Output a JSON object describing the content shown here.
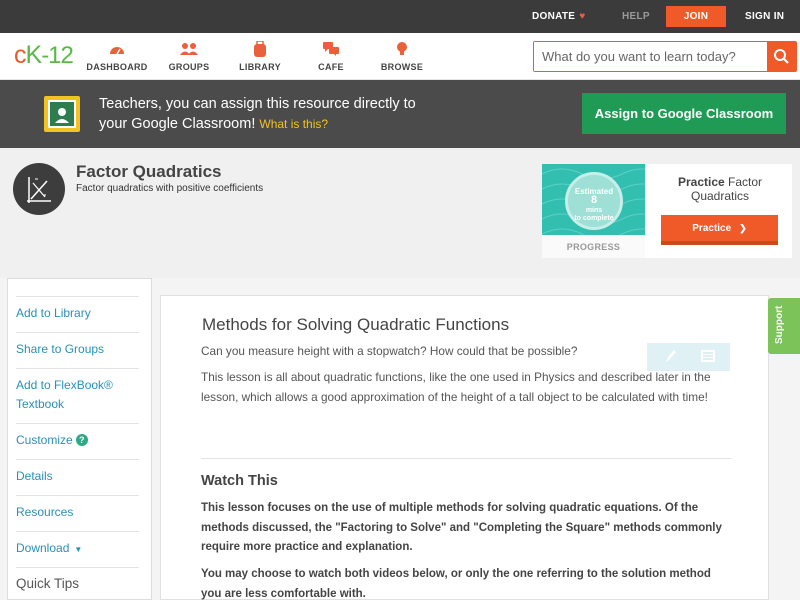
{
  "topbar": {
    "donate": "DONATE",
    "help": "HELP",
    "join": "JOIN",
    "signin": "SIGN IN"
  },
  "logo": {
    "c": "c",
    "k": "K",
    "num": "-12"
  },
  "nav": {
    "items": [
      {
        "label": "DASHBOARD",
        "icon": "gauge-icon"
      },
      {
        "label": "GROUPS",
        "icon": "people-icon"
      },
      {
        "label": "LIBRARY",
        "icon": "backpack-icon"
      },
      {
        "label": "CAFE",
        "icon": "chat-bubbles-icon"
      },
      {
        "label": "BROWSE",
        "icon": "lightbulb-icon"
      }
    ]
  },
  "search": {
    "placeholder": "What do you want to learn today?"
  },
  "classroom_banner": {
    "text_line1": "Teachers, you can assign this resource directly to",
    "text_line2": "your Google Classroom!",
    "what_link": "What is this?",
    "assign_button": "Assign to Google Classroom"
  },
  "concept": {
    "title": "Factor Quadratics",
    "subtitle": "Factor quadratics with positive coefficients"
  },
  "practice": {
    "estimated_1": "Estimated",
    "estimated_2": "8",
    "estimated_2b": "mins",
    "estimated_3": "to complete",
    "progress_label": "PROGRESS",
    "title_bold": "Practice",
    "title_rest": "Factor Quadratics",
    "button": "Practice"
  },
  "sidebar": {
    "items": [
      {
        "label": "Add to Library"
      },
      {
        "label": "Share to Groups"
      },
      {
        "label": "Add to FlexBook®"
      },
      {
        "label": "Textbook"
      },
      {
        "label": "Customize"
      },
      {
        "label": "Details"
      },
      {
        "label": "Resources"
      },
      {
        "label": "Download"
      }
    ],
    "quick_tips": "Quick Tips"
  },
  "lesson": {
    "title": "Methods for Solving Quadratic Functions",
    "p1": "Can you measure height with a stopwatch? How could that be possible?",
    "p2": "This lesson is all about quadratic functions, like the one used in Physics and described later in the lesson, which allows a good approximation of the height of a tall object to be calculated with time!",
    "watch_title": "Watch This",
    "watch_p1": "This lesson focuses on the use of multiple methods for solving quadratic equations. Of the methods discussed, the \"Factoring to Solve\" and \"Completing the Square\" methods commonly require more practice and explanation.",
    "watch_p2": "You may choose to watch both videos below, or only the one referring to the solution method you are less comfortable with."
  },
  "support": {
    "label": "Support"
  },
  "colors": {
    "accent": "#f05a28",
    "classroom_green": "#1f9b55",
    "link_blue": "#2a8fb5",
    "support_green": "#7cc35a"
  }
}
